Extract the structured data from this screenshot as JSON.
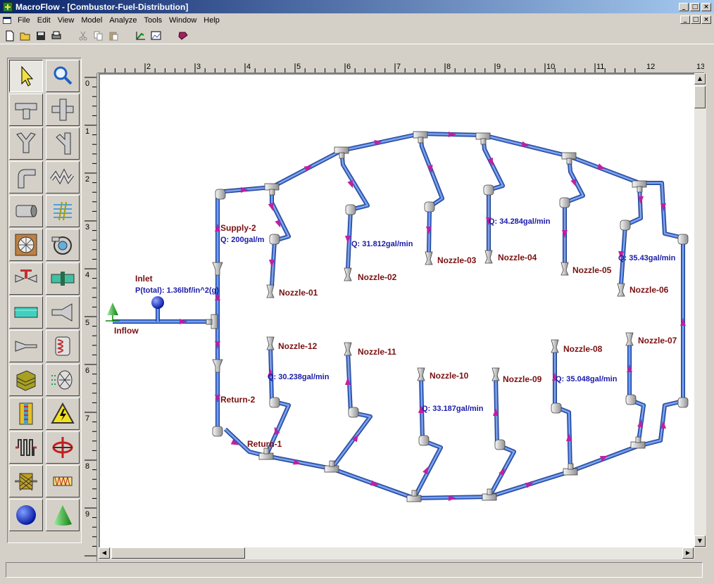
{
  "window": {
    "title": "MacroFlow - [Combustor-Fuel-Distribution]",
    "btn_min": "_",
    "btn_max": "□",
    "btn_close": "×"
  },
  "menu": {
    "items": [
      "File",
      "Edit",
      "View",
      "Model",
      "Analyze",
      "Tools",
      "Window",
      "Help"
    ]
  },
  "ruler": {
    "h_labels": [
      "2",
      "3",
      "4",
      "5",
      "6",
      "7",
      "8",
      "9",
      "10",
      "11",
      "12",
      "13"
    ],
    "v_labels": [
      "0",
      "1",
      "2",
      "3",
      "4",
      "5",
      "6",
      "7",
      "8",
      "9"
    ]
  },
  "palette": {
    "tools": [
      "select-arrow",
      "zoom-magnifier",
      "tee-fitting",
      "cross-fitting",
      "wye-fitting",
      "wye-fitting-2",
      "elbow-fitting",
      "flexible-hose",
      "pipe-segment",
      "filter-screen",
      "fan",
      "pump",
      "valve",
      "orifice",
      "heat-exchanger-tube",
      "nozzle-reducer",
      "expander",
      "coil-exchanger",
      "stack-plates",
      "mesh-filter",
      "striped-panel",
      "high-voltage",
      "radiator",
      "rotating-element",
      "screen-element",
      "spring-element",
      "sphere-source",
      "cone-inflow"
    ]
  },
  "diagram": {
    "inlet_title": "Inlet",
    "inlet_pressure": "P(total): 1.36lbf/in^2(g)",
    "inflow": "Inflow",
    "supply": "Supply-2",
    "supply_flow": "Q: 200gal/m",
    "return2": "Return-2",
    "return1": "Return-1",
    "nozzles": [
      {
        "name": "Nozzle-01"
      },
      {
        "name": "Nozzle-02"
      },
      {
        "name": "Nozzle-03"
      },
      {
        "name": "Nozzle-04"
      },
      {
        "name": "Nozzle-05"
      },
      {
        "name": "Nozzle-06"
      },
      {
        "name": "Nozzle-07"
      },
      {
        "name": "Nozzle-08"
      },
      {
        "name": "Nozzle-09"
      },
      {
        "name": "Nozzle-10"
      },
      {
        "name": "Nozzle-11"
      },
      {
        "name": "Nozzle-12"
      }
    ],
    "flows": {
      "q02": "Q: 31.812gal/min",
      "q04": "Q: 34.284gal/min",
      "q06": "Q: 35.43gal/min",
      "q12": "Q: 30.238gal/min",
      "q10": "Q: 33.187gal/min",
      "q08": "Q: 35.048gal/min"
    }
  },
  "colors": {
    "pipe": "#4a78d8",
    "pipe_edge": "#1c3a8a",
    "arrow": "#c020a0",
    "node_label": "#7a1010",
    "flow_label": "#1a1aa8"
  }
}
